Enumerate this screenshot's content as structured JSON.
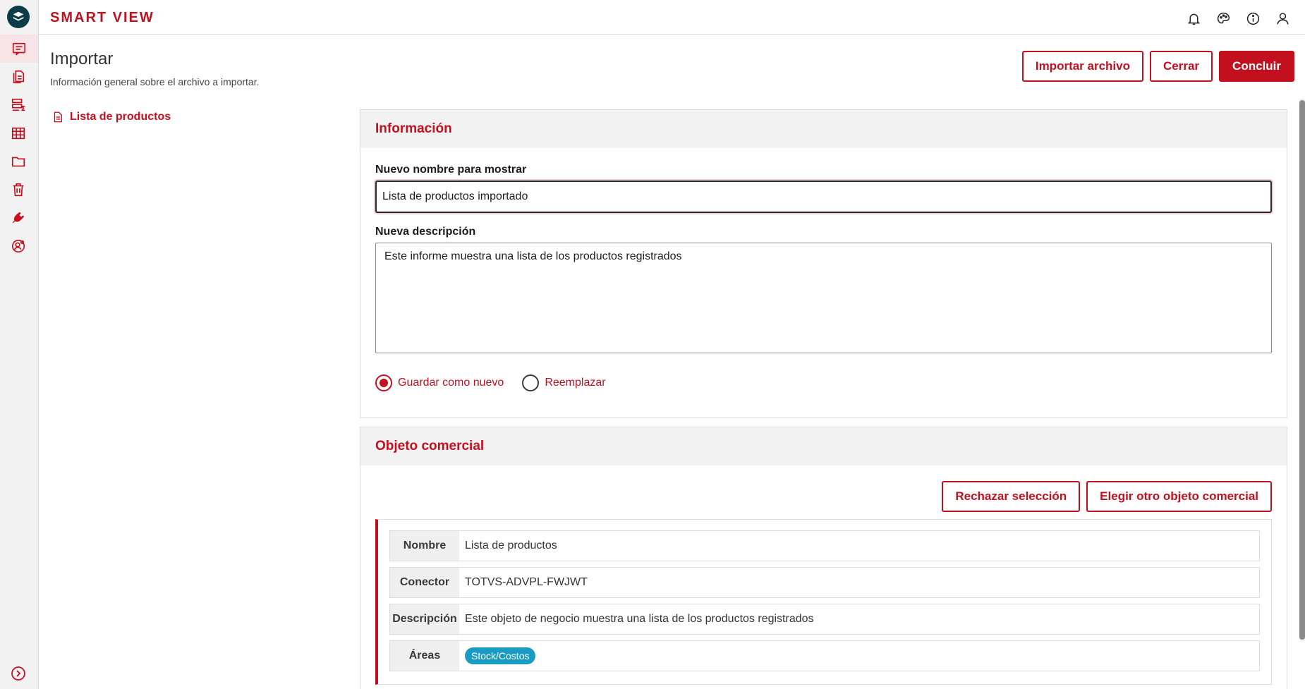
{
  "app": {
    "brand": "SMART VIEW"
  },
  "sidebar": {
    "items": [
      {
        "name": "reports",
        "icon": "document-list-icon",
        "active": true
      },
      {
        "name": "documents",
        "icon": "document-copy-icon"
      },
      {
        "name": "analysis",
        "icon": "sum-table-icon"
      },
      {
        "name": "grid",
        "icon": "grid-table-icon"
      },
      {
        "name": "folder",
        "icon": "folder-icon"
      },
      {
        "name": "trash",
        "icon": "trash-icon"
      },
      {
        "name": "plugin",
        "icon": "plug-icon"
      },
      {
        "name": "user-settings",
        "icon": "user-settings-icon"
      }
    ]
  },
  "header": {
    "icons": [
      "bell-icon",
      "palette-icon",
      "info-icon",
      "user-icon"
    ]
  },
  "page": {
    "title": "Importar",
    "subtitle": "Información general sobre el archivo a importar."
  },
  "actions": {
    "import_file": "Importar archivo",
    "close": "Cerrar",
    "finish": "Concluir"
  },
  "left_list": {
    "item": "Lista de productos"
  },
  "info_card": {
    "title": "Información",
    "name_label": "Nuevo nombre para mostrar",
    "name_value": "Lista de productos importado",
    "desc_label": "Nueva descripción",
    "desc_value": "Este informe muestra una lista de los productos registrados",
    "radio_new": "Guardar como nuevo",
    "radio_replace": "Reemplazar"
  },
  "object_card": {
    "title": "Objeto comercial",
    "reject_label": "Rechazar selección",
    "choose_label": "Elegir otro objeto comercial",
    "rows": {
      "name_key": "Nombre",
      "name_val": "Lista de productos",
      "connector_key": "Conector",
      "connector_val": "TOTVS-ADVPL-FWJWT",
      "desc_key": "Descripción",
      "desc_val": "Este objeto de negocio muestra una lista de los productos registrados",
      "areas_key": "Áreas",
      "areas_val": "Stock/Costos"
    }
  },
  "colors": {
    "accent": "#c3101f",
    "badge": "#1a9bc1",
    "logo": "#0c3b4a"
  }
}
